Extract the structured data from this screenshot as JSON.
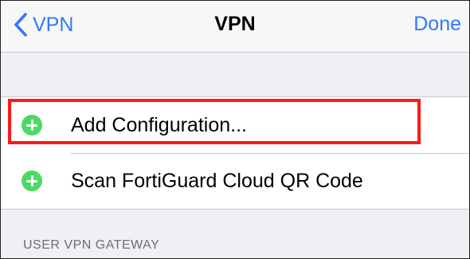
{
  "navbar": {
    "back_label": "VPN",
    "title": "VPN",
    "done_label": "Done"
  },
  "config_group": {
    "items": [
      {
        "label": "Add Configuration...",
        "icon": "plus-circle-icon"
      },
      {
        "label": "Scan FortiGuard Cloud QR Code",
        "icon": "plus-circle-icon"
      }
    ]
  },
  "section": {
    "header": "USER VPN GATEWAY"
  },
  "colors": {
    "accent": "#3478f6",
    "plus_icon": "#4cd964",
    "highlight": "#ff1a1a",
    "background": "#efeff4"
  }
}
